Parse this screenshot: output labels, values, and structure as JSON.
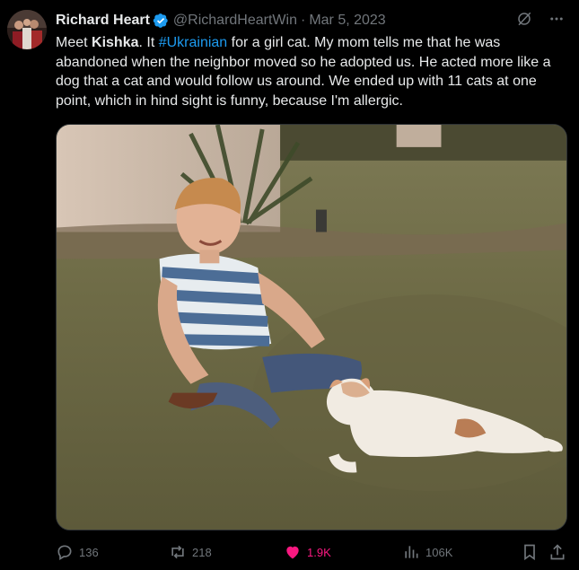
{
  "author": {
    "name": "Richard Heart",
    "handle": "@RichardHeartWin",
    "separator": "·",
    "date": "Mar 5, 2023",
    "verified": true
  },
  "tweet": {
    "text_1": "Meet ",
    "bold": "Kishka",
    "text_2": ". It ",
    "hashtag": "#Ukrainian",
    "text_3": " for a girl cat. My mom tells me that he was abandoned when the neighbor moved so he adopted us. He acted more like a dog that a cat and would follow us around. We ended up with 11 cats at one point, which in hind sight is funny, because I'm allergic."
  },
  "actions": {
    "replies": "136",
    "reposts": "218",
    "likes": "1.9K",
    "views": "106K"
  },
  "icons": {
    "verified": "verified-badge-icon",
    "grok": "grok-icon",
    "more": "more-options-icon",
    "reply": "reply-icon",
    "repost": "repost-icon",
    "like": "heart-icon",
    "views": "views-icon",
    "bookmark": "bookmark-icon",
    "share": "share-icon"
  },
  "colors": {
    "background": "#000000",
    "text": "#e7e9ea",
    "muted": "#71767b",
    "link": "#1d9bf0",
    "like": "#f91880",
    "verified": "#1d9bf0"
  }
}
